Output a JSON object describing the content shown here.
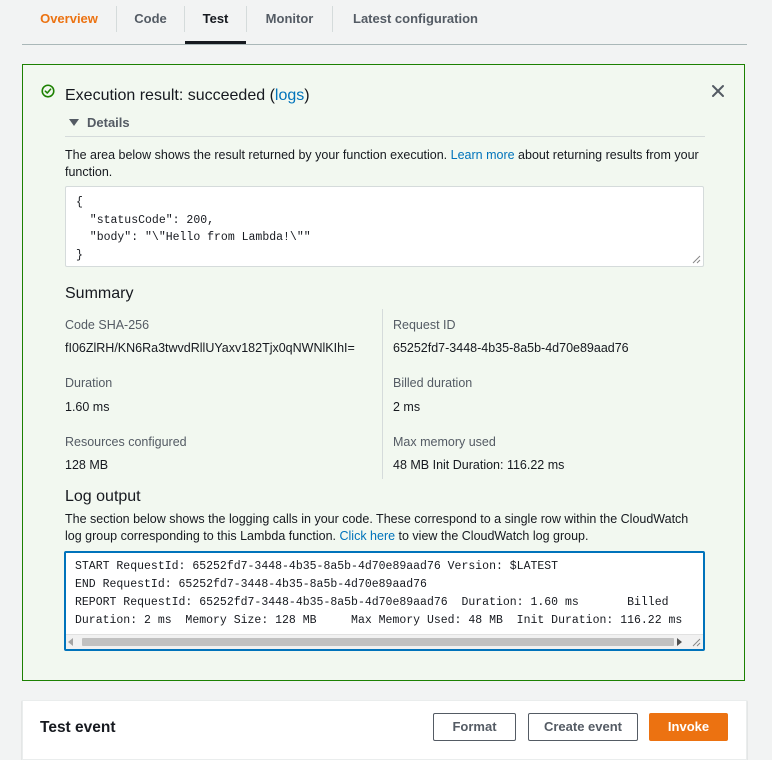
{
  "tabs": [
    {
      "label": "Overview"
    },
    {
      "label": "Code"
    },
    {
      "label": "Test"
    },
    {
      "label": "Monitor"
    },
    {
      "label": "Latest configuration"
    }
  ],
  "result": {
    "title_prefix": "Execution result: succeeded (",
    "logs_link": "logs",
    "title_suffix": ")",
    "details_label": "Details",
    "desc_before": "The area below shows the result returned by your function execution. ",
    "desc_link": "Learn more",
    "desc_after": " about returning results from your function.",
    "output": "{\n  \"statusCode\": 200,\n  \"body\": \"\\\"Hello from Lambda!\\\"\"\n}"
  },
  "summary": {
    "title": "Summary",
    "code_sha_label": "Code SHA-256",
    "code_sha_value": "fI06ZlRH/KN6Ra3twvdRllUYaxv182Tjx0qNWNlKIhI=",
    "request_id_label": "Request ID",
    "request_id_value": "65252fd7-3448-4b35-8a5b-4d70e89aad76",
    "duration_label": "Duration",
    "duration_value": "1.60 ms",
    "billed_label": "Billed duration",
    "billed_value": "2 ms",
    "resources_label": "Resources configured",
    "resources_value": "128 MB",
    "maxmem_label": "Max memory used",
    "maxmem_value": "48 MB Init Duration: 116.22 ms"
  },
  "log": {
    "title": "Log output",
    "desc_before": "The section below shows the logging calls in your code. These correspond to a single row within the CloudWatch log group corresponding to this Lambda function. ",
    "desc_link": "Click here",
    "desc_after": " to view the CloudWatch log group.",
    "text": "START RequestId: 65252fd7-3448-4b35-8a5b-4d70e89aad76 Version: $LATEST\nEND RequestId: 65252fd7-3448-4b35-8a5b-4d70e89aad76\nREPORT RequestId: 65252fd7-3448-4b35-8a5b-4d70e89aad76  Duration: 1.60 ms       Billed\nDuration: 2 ms  Memory Size: 128 MB     Max Memory Used: 48 MB  Init Duration: 116.22 ms"
  },
  "test_event": {
    "title": "Test event",
    "format_label": "Format",
    "create_label": "Create event",
    "invoke_label": "Invoke"
  },
  "colors": {
    "accent": "#ec7211",
    "link": "#0073bb",
    "success": "#1d8102",
    "success_bg": "#f2f8f0"
  }
}
